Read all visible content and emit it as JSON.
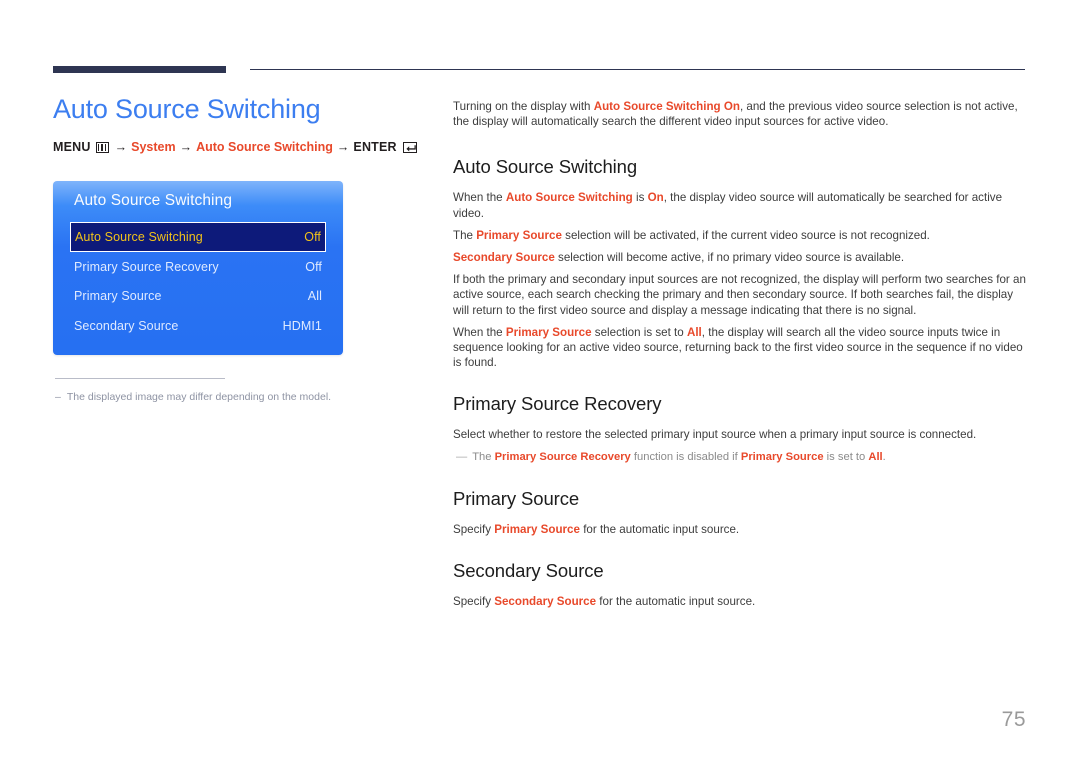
{
  "page": {
    "number": "75"
  },
  "left": {
    "title": "Auto Source Switching",
    "breadcrumb": {
      "menu_label": "MENU",
      "menu_icon": "menu-grid-icon",
      "arrow": "→",
      "system_label": "System",
      "feature_label": "Auto Source Switching",
      "enter_label": "ENTER",
      "enter_icon": "enter-return-icon"
    },
    "osd": {
      "title": "Auto Source Switching",
      "rows": [
        {
          "label": "Auto Source Switching",
          "value": "Off",
          "selected": true
        },
        {
          "label": "Primary Source Recovery",
          "value": "Off",
          "selected": false
        },
        {
          "label": "Primary Source",
          "value": "All",
          "selected": false
        },
        {
          "label": "Secondary Source",
          "value": "HDMI1",
          "selected": false
        }
      ]
    },
    "note": {
      "dash": "–",
      "text": "The displayed image may differ depending on the model."
    }
  },
  "right": {
    "intro": {
      "p1_a": "Turning on the display with ",
      "p1_red": "Auto Source Switching On",
      "p1_b": ", and the previous video source selection is not active, the display will automatically search the different video input sources for active video."
    },
    "sections": [
      {
        "heading": "Auto Source Switching",
        "paragraphs": [
          {
            "parts": [
              {
                "t": "When the ",
                "red": false
              },
              {
                "t": "Auto Source Switching",
                "red": true
              },
              {
                "t": " is ",
                "red": false
              },
              {
                "t": "On",
                "red": true
              },
              {
                "t": ", the display video source will automatically be searched for active video.",
                "red": false
              }
            ]
          },
          {
            "parts": [
              {
                "t": "The ",
                "red": false
              },
              {
                "t": "Primary Source",
                "red": true
              },
              {
                "t": " selection will be activated, if the current video source is not recognized.",
                "red": false
              }
            ]
          },
          {
            "parts": [
              {
                "t": "Secondary Source",
                "red": true
              },
              {
                "t": " selection will become active, if no primary video source is available.",
                "red": false
              }
            ]
          },
          {
            "parts": [
              {
                "t": "If both the primary and secondary input sources are not recognized, the display will perform two searches for an active source, each search checking the primary and then secondary source. If both searches fail, the display will return to the first video source and display a message indicating that there is no signal.",
                "red": false
              }
            ]
          },
          {
            "parts": [
              {
                "t": "When the ",
                "red": false
              },
              {
                "t": "Primary Source",
                "red": true
              },
              {
                "t": " selection is set to ",
                "red": false
              },
              {
                "t": "All",
                "red": true
              },
              {
                "t": ", the display will search all the video source inputs twice in sequence looking for an active video source, returning back to the first video source in the sequence if no video is found.",
                "red": false
              }
            ]
          }
        ],
        "note": null
      },
      {
        "heading": "Primary Source Recovery",
        "paragraphs": [
          {
            "parts": [
              {
                "t": "Select whether to restore the selected primary input source when a primary input source is connected.",
                "red": false
              }
            ]
          }
        ],
        "note": {
          "dash": "—",
          "parts": [
            {
              "t": "The ",
              "red": false
            },
            {
              "t": "Primary Source Recovery",
              "red": true
            },
            {
              "t": " function is disabled if ",
              "red": false
            },
            {
              "t": "Primary Source",
              "red": true
            },
            {
              "t": " is set to ",
              "red": false
            },
            {
              "t": "All",
              "red": true
            },
            {
              "t": ".",
              "red": false
            }
          ]
        }
      },
      {
        "heading": "Primary Source",
        "paragraphs": [
          {
            "parts": [
              {
                "t": "Specify ",
                "red": false
              },
              {
                "t": "Primary Source",
                "red": true
              },
              {
                "t": " for the automatic input source.",
                "red": false
              }
            ]
          }
        ],
        "note": null
      },
      {
        "heading": "Secondary Source",
        "paragraphs": [
          {
            "parts": [
              {
                "t": "Specify ",
                "red": false
              },
              {
                "t": "Secondary Source",
                "red": true
              },
              {
                "t": " for the automatic input source.",
                "red": false
              }
            ]
          }
        ],
        "note": null
      }
    ]
  }
}
